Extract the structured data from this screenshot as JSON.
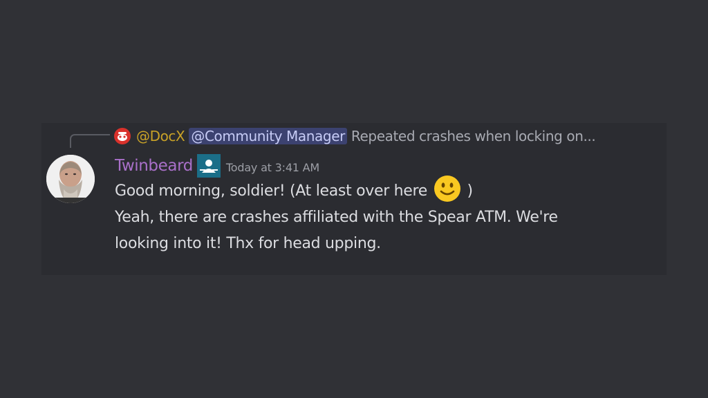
{
  "reply": {
    "author": "@DocX",
    "mention": "@Community Manager",
    "text": "Repeated crashes when locking on..."
  },
  "message": {
    "username": "Twinbeard",
    "timestamp": "Today at 3:41 AM",
    "line1_before": "Good morning, soldier! (At least over here",
    "line1_after": ")",
    "line2": "Yeah, there are crashes affiliated with the Spear ATM. We're",
    "line3": "looking into it! Thx for head upping.",
    "emoji": "slightly-smiling-face-icon"
  },
  "colors": {
    "background": "#303136",
    "message_background": "#2b2c31",
    "username": "#a970c9",
    "reply_author": "#c9a227",
    "mention_bg": "#3c4270",
    "mention_text": "#c7ccf6",
    "text": "#dcdde1"
  }
}
